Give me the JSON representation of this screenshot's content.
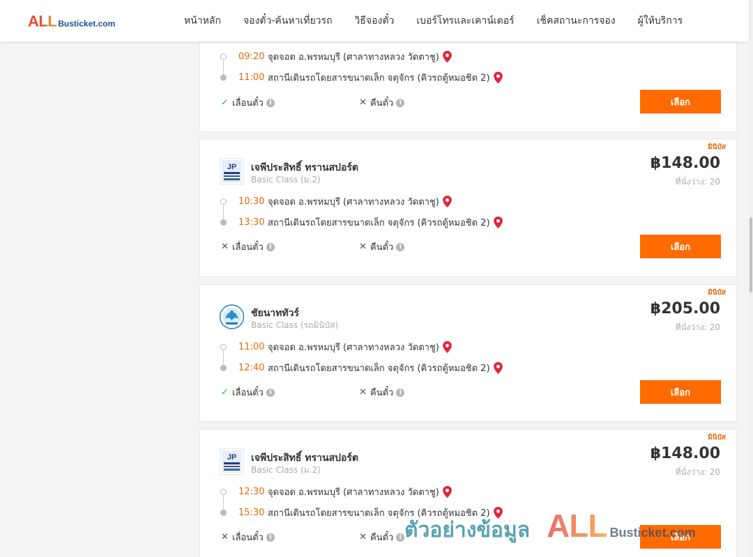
{
  "header": {
    "logo_all": "ALL",
    "logo_rest": "Busticket.com",
    "nav": [
      "หน้าหลัก",
      "จองตั๋ว-ค้นหาเที่ยวรถ",
      "วิธีจองตั๋ว",
      "เบอร์โทรและเคาน์เตอร์",
      "เช็คสถานะการจอง",
      "ผู้ให้บริการ"
    ]
  },
  "colors": {
    "accent": "#ff6b00",
    "time": "#e36c09",
    "ok": "#3aa84a",
    "pin": "#e3253a"
  },
  "trips": [
    {
      "badge": "",
      "operator": "",
      "bus_class": "",
      "price": "",
      "seats": "",
      "depart_time": "09:20",
      "depart_place": "จุดจอด อ.พรหมบุรี (ศาลาทางหลวง วัดตาชู)",
      "arrive_time": "11:00",
      "arrive_place": "สถานีเดินรถโดยสารขนาดเล็ก จตุจักร (คิวรถตู้หมอชิต 2)",
      "change_label": "เลื่อนตั๋ว",
      "change_allowed": true,
      "refund_label": "คืนตั๋ว",
      "refund_allowed": false,
      "select_label": "เลือก"
    },
    {
      "badge": "มินิบัส",
      "operator": "เจพีประสิทธิ์ ทรานสปอร์ต",
      "bus_class": "Basic Class (ม.2)",
      "logo_icon": "jp-operator-logo",
      "price": "฿148.00",
      "seats": "ที่นั่งว่าง: 20",
      "depart_time": "10:30",
      "depart_place": "จุดจอด อ.พรหมบุรี (ศาลาทางหลวง วัดตาชู)",
      "arrive_time": "13:30",
      "arrive_place": "สถานีเดินรถโดยสารขนาดเล็ก จตุจักร (คิวรถตู้หมอชิต 2)",
      "change_label": "เลื่อนตั๋ว",
      "change_allowed": false,
      "refund_label": "คืนตั๋ว",
      "refund_allowed": false,
      "select_label": "เลือก"
    },
    {
      "badge": "มินิบัส",
      "operator": "ชัยนาททัวร์",
      "bus_class": "Basic Class (รถมินิบัส)",
      "logo_icon": "chainat-tour-logo",
      "price": "฿205.00",
      "seats": "ที่นั่งว่าง: 20",
      "depart_time": "11:00",
      "depart_place": "จุดจอด อ.พรหมบุรี (ศาลาทางหลวง วัดตาชู)",
      "arrive_time": "12:40",
      "arrive_place": "สถานีเดินรถโดยสารขนาดเล็ก จตุจักร (คิวรถตู้หมอชิต 2)",
      "change_label": "เลื่อนตั๋ว",
      "change_allowed": true,
      "refund_label": "คืนตั๋ว",
      "refund_allowed": false,
      "select_label": "เลือก"
    },
    {
      "badge": "มินิบัส",
      "operator": "เจพีประสิทธิ์ ทรานสปอร์ต",
      "bus_class": "Basic Class (ม.2)",
      "logo_icon": "jp-operator-logo",
      "price": "฿148.00",
      "seats": "ที่นั่งว่าง: 20",
      "depart_time": "12:30",
      "depart_place": "จุดจอด อ.พรหมบุรี (ศาลาทางหลวง วัดตาชู)",
      "arrive_time": "15:30",
      "arrive_place": "สถานีเดินรถโดยสารขนาดเล็ก จตุจักร (คิวรถตู้หมอชิต 2)",
      "change_label": "เลื่อนตั๋ว",
      "change_allowed": false,
      "refund_label": "คืนตั๋ว",
      "refund_allowed": false,
      "select_label": "เลือก"
    }
  ],
  "watermark": {
    "text": "ตัวอย่างข้อมูล",
    "all": "ALL",
    "rest": "Busticket.com"
  }
}
